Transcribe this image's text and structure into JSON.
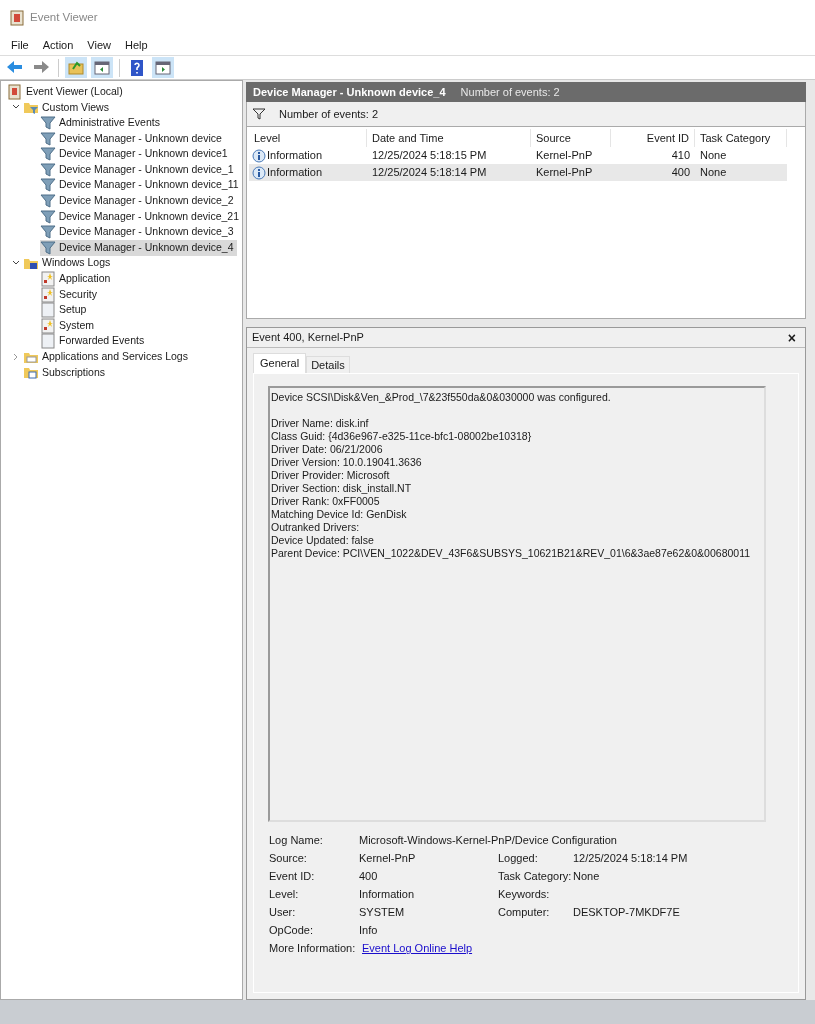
{
  "window": {
    "title": "Event Viewer"
  },
  "menu": [
    "File",
    "Action",
    "View",
    "Help"
  ],
  "toolbar": [
    {
      "kind": "back"
    },
    {
      "kind": "forward"
    },
    {
      "kind": "up"
    },
    {
      "kind": "pane-left"
    },
    {
      "kind": "help"
    },
    {
      "kind": "pane-right"
    }
  ],
  "tree": [
    {
      "label": "Event Viewer (Local)",
      "kind": "root",
      "selected": false,
      "children": [
        {
          "label": "Custom Views",
          "kind": "folder-filter",
          "expanded": true,
          "selected": false,
          "children": [
            {
              "label": "Administrative Events",
              "kind": "filter",
              "selected": false
            },
            {
              "label": "Device Manager - Unknown device",
              "kind": "filter",
              "selected": false
            },
            {
              "label": "Device Manager - Unknown device1",
              "kind": "filter",
              "selected": false
            },
            {
              "label": "Device Manager - Unknown device_1",
              "kind": "filter",
              "selected": false
            },
            {
              "label": "Device Manager - Unknown device_11",
              "kind": "filter",
              "selected": false
            },
            {
              "label": "Device Manager - Unknown device_2",
              "kind": "filter",
              "selected": false
            },
            {
              "label": "Device Manager - Unknown device_21",
              "kind": "filter",
              "selected": false
            },
            {
              "label": "Device Manager - Unknown device_3",
              "kind": "filter",
              "selected": false
            },
            {
              "label": "Device Manager - Unknown device_4",
              "kind": "filter",
              "selected": true
            }
          ]
        },
        {
          "label": "Windows Logs",
          "kind": "folder-logs",
          "expanded": true,
          "selected": false,
          "children": [
            {
              "label": "Application",
              "kind": "log",
              "selected": false
            },
            {
              "label": "Security",
              "kind": "log",
              "selected": false
            },
            {
              "label": "Setup",
              "kind": "log-plain",
              "selected": false
            },
            {
              "label": "System",
              "kind": "log",
              "selected": false
            },
            {
              "label": "Forwarded Events",
              "kind": "log-plain",
              "selected": false
            }
          ]
        },
        {
          "label": "Applications and Services Logs",
          "kind": "folder",
          "expanded": false,
          "selected": false
        },
        {
          "label": "Subscriptions",
          "kind": "subscriptions",
          "selected": false
        }
      ]
    }
  ],
  "view_header": {
    "title": "Device Manager - Unknown device_4",
    "count": "Number of events: 2"
  },
  "filter_bar": {
    "text": "Number of events: 2"
  },
  "table": {
    "columns": [
      "Level",
      "Date and Time",
      "Source",
      "Event ID",
      "Task Category"
    ],
    "rows": [
      {
        "cells": [
          "Information",
          "12/25/2024 5:18:15 PM",
          "Kernel-PnP",
          "410",
          "None"
        ],
        "selected": false
      },
      {
        "cells": [
          "Information",
          "12/25/2024 5:18:14 PM",
          "Kernel-PnP",
          "400",
          "None"
        ],
        "selected": true
      }
    ]
  },
  "details": {
    "title": "Event 400, Kernel-PnP",
    "close": "×",
    "tabs": [
      {
        "label": "General",
        "selected": true
      },
      {
        "label": "Details",
        "selected": false
      }
    ],
    "message": {
      "summary": "Device SCSI\\Disk&Ven_&Prod_\\7&23f550da&0&030000 was configured.",
      "lines": [
        "Driver Name: disk.inf",
        "Class Guid: {4d36e967-e325-11ce-bfc1-08002be10318}",
        "Driver Date: 06/21/2006",
        "Driver Version: 10.0.19041.3636",
        "Driver Provider: Microsoft",
        "Driver Section: disk_install.NT",
        "Driver Rank: 0xFF0005",
        "Matching Device Id: GenDisk",
        "Outranked Drivers:",
        "Device Updated: false",
        "Parent Device: PCI\\VEN_1022&DEV_43F6&SUBSYS_10621B21&REV_01\\6&3ae87e62&0&00680011"
      ]
    },
    "log_name": {
      "label": "Log Name:",
      "value": "Microsoft-Windows-Kernel-PnP/Device Configuration"
    },
    "properties": [
      [
        {
          "label": "Source:",
          "value": "Kernel-PnP"
        },
        {
          "label": "Logged:",
          "value": "12/25/2024 5:18:14 PM"
        }
      ],
      [
        {
          "label": "Event ID:",
          "value": "400"
        },
        {
          "label": "Task Category:",
          "value": "None"
        }
      ],
      [
        {
          "label": "Level:",
          "value": "Information"
        },
        {
          "label": "Keywords:"
        }
      ],
      [
        {
          "label": "User:",
          "value": "SYSTEM"
        },
        {
          "label": "Computer:",
          "value": "DESKTOP-7MKDF7E"
        }
      ],
      [
        {
          "label": "OpCode:",
          "value": "Info"
        }
      ]
    ],
    "more_info": {
      "label": "More Information:",
      "link": "Event Log Online Help"
    }
  }
}
